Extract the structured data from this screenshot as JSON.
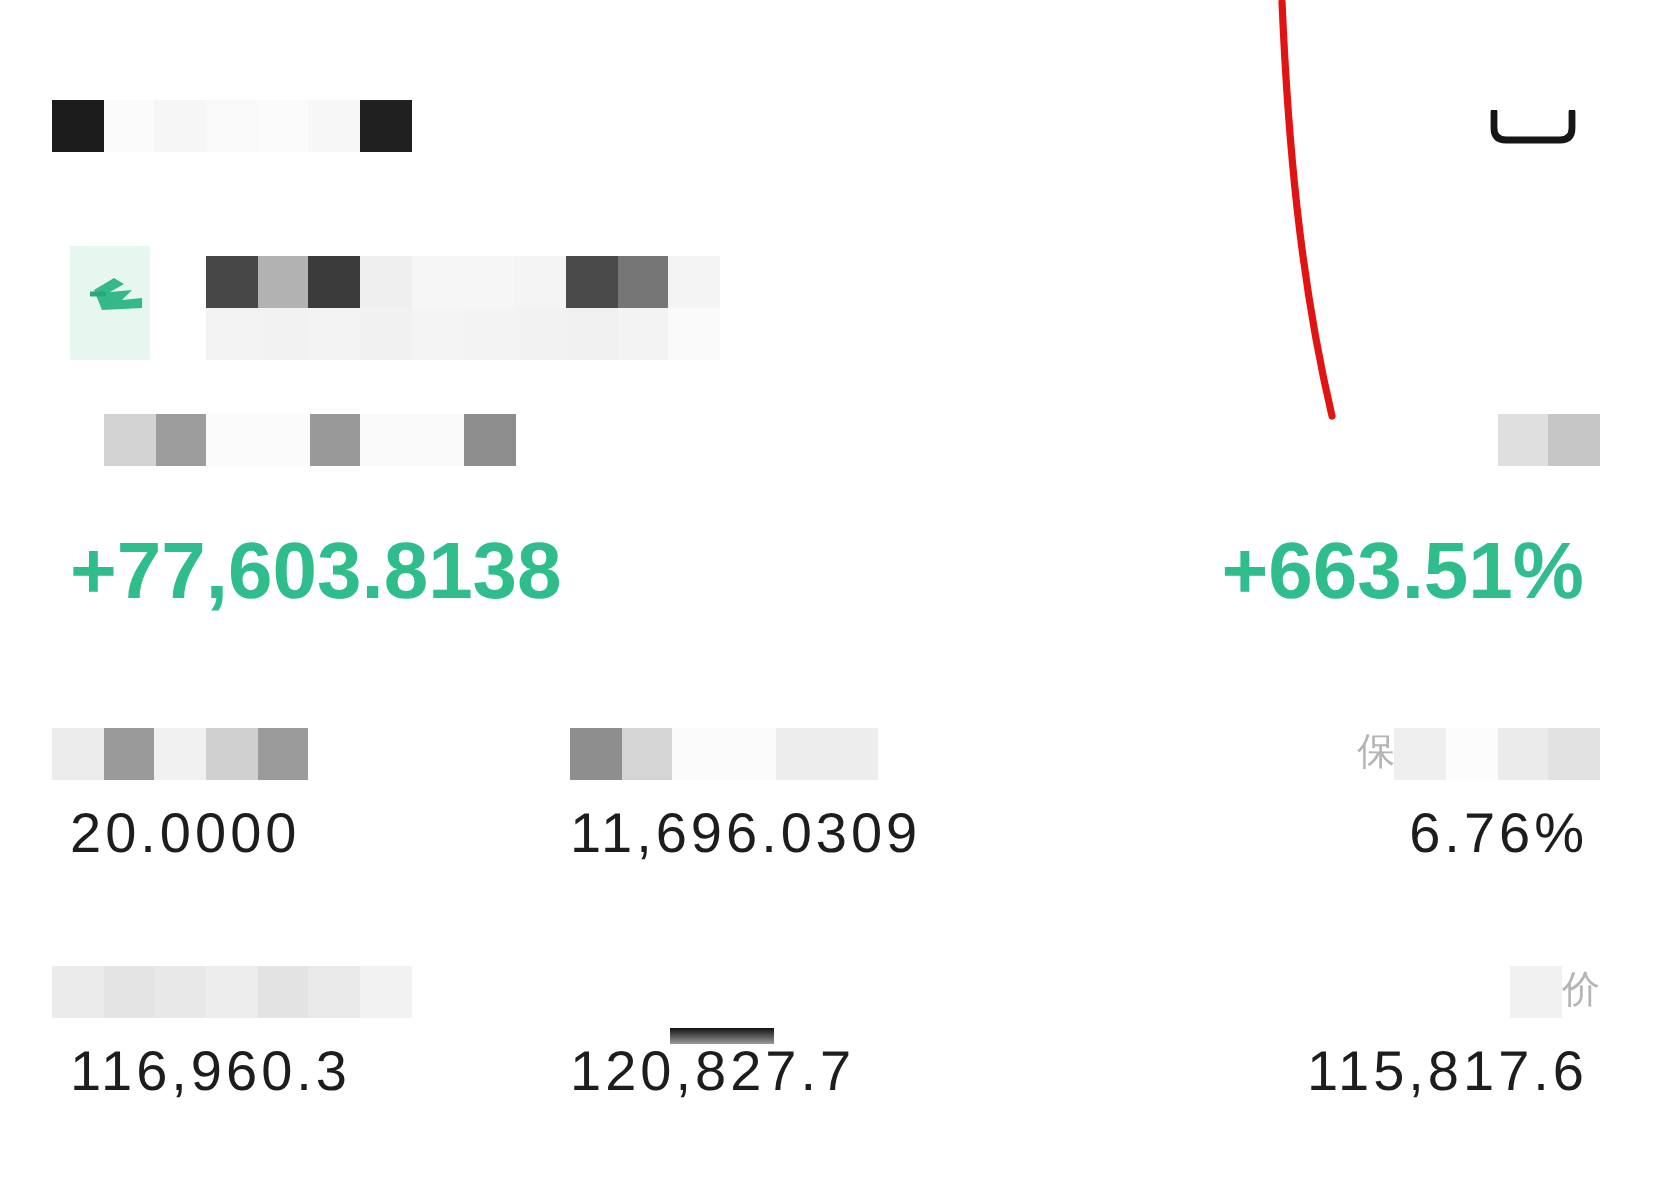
{
  "header": {
    "title_redacted": true
  },
  "position": {
    "name_redacted": true
  },
  "pnl": {
    "label": [
      {
        "kind": "mosaic"
      }
    ],
    "value": "+77,603.8138"
  },
  "return_rate": {
    "label": [
      {
        "kind": "mosaic"
      }
    ],
    "value": "+663.51%"
  },
  "stats": [
    {
      "label": [
        {
          "kind": "mosaic"
        }
      ],
      "value": "20.0000"
    },
    {
      "label": [
        {
          "kind": "mosaic"
        }
      ],
      "value": "11,696.0309"
    },
    {
      "label": [
        {
          "kind": "text",
          "text": "保"
        },
        {
          "kind": "mosaic"
        }
      ],
      "value": "6.76%"
    },
    {
      "label": [
        {
          "kind": "mosaic"
        }
      ],
      "value": "116,960.3"
    },
    {
      "label": [
        {
          "kind": "block"
        }
      ],
      "value": "120,827.7"
    },
    {
      "label": [
        {
          "kind": "mosaic"
        },
        {
          "kind": "text",
          "text": "价"
        }
      ],
      "value": "115,817.6"
    }
  ]
}
